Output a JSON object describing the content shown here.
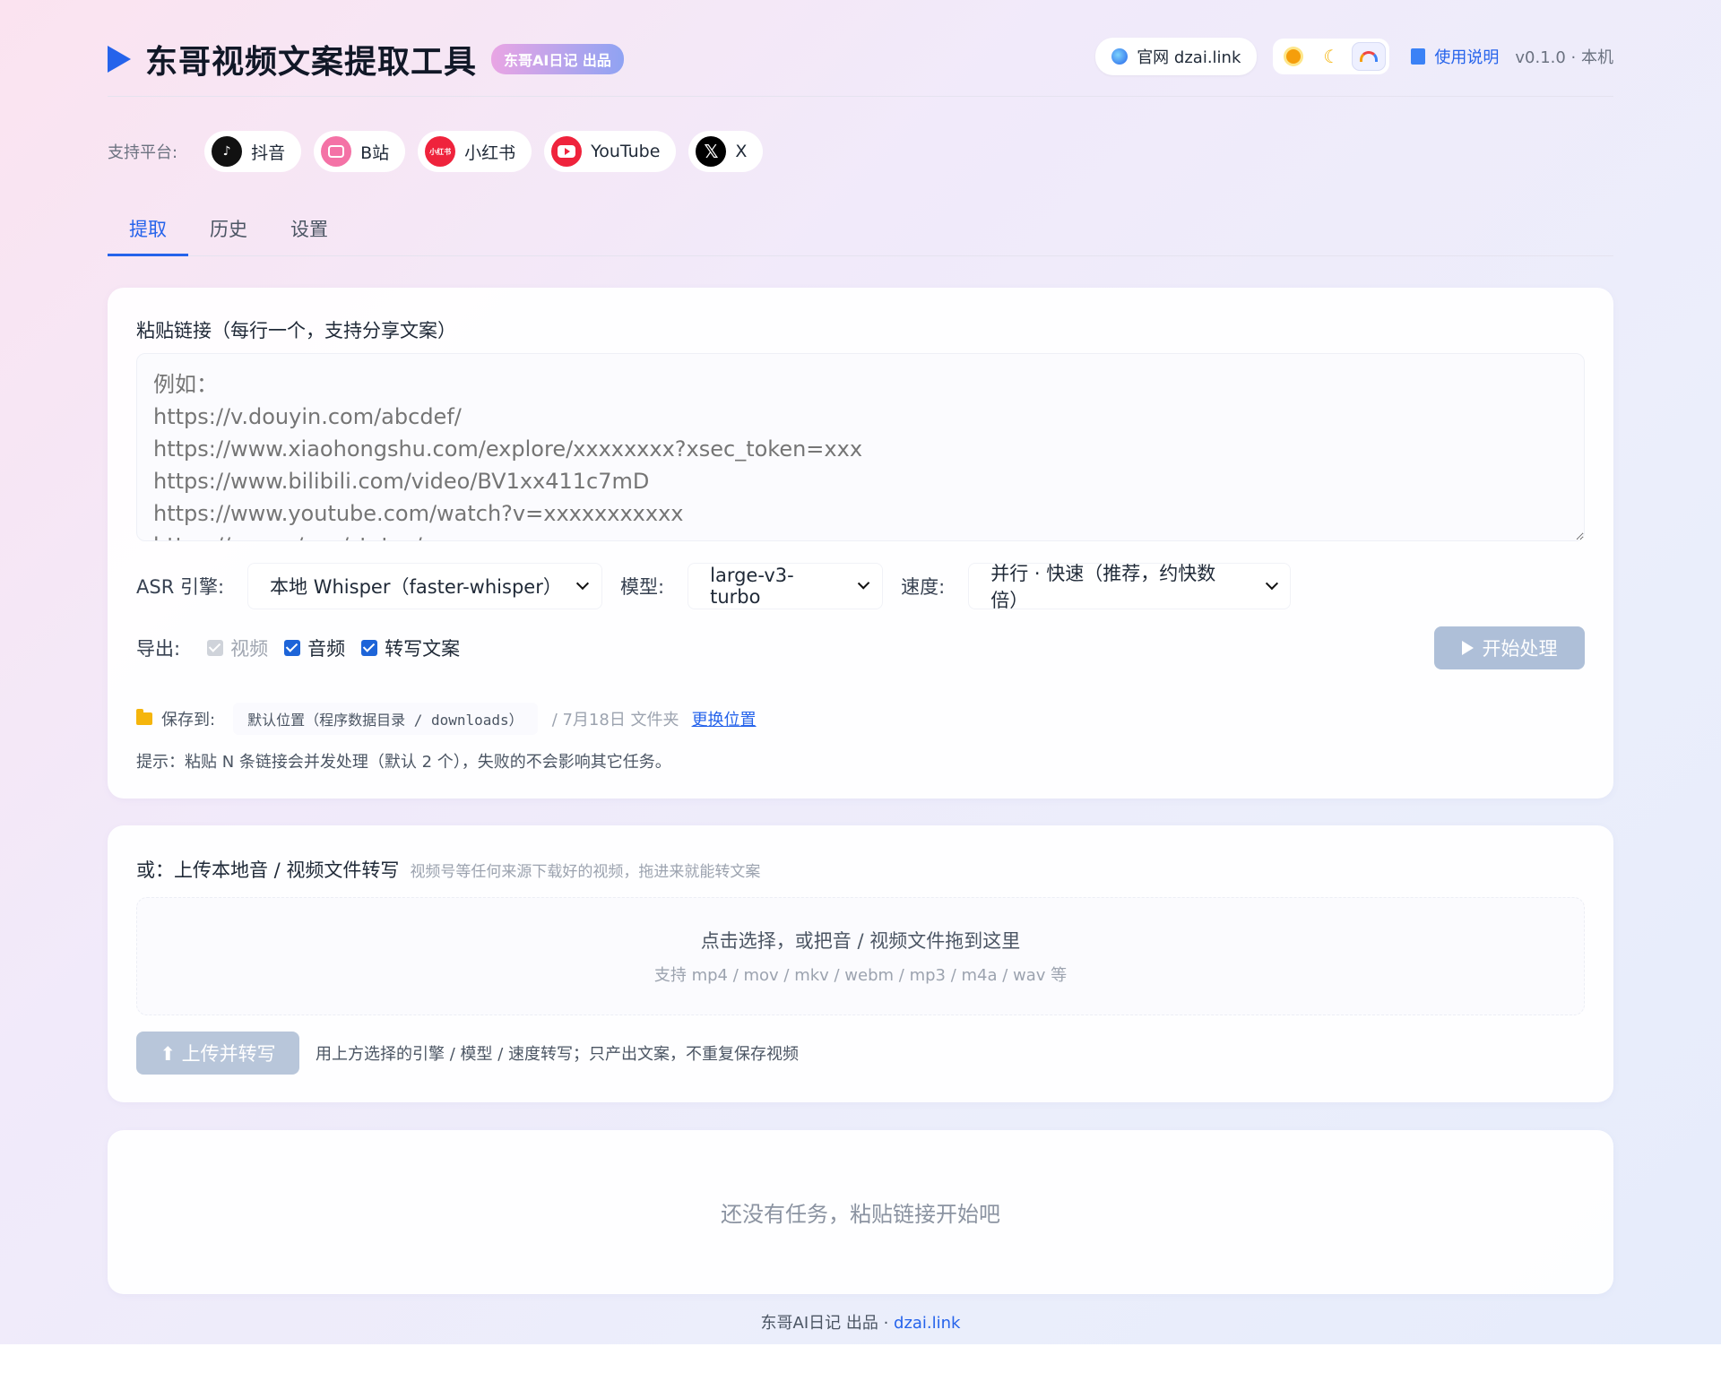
{
  "header": {
    "app_title": "东哥视频文案提取工具",
    "brand_badge": "东哥AI日记 出品",
    "site_label": "官网 dzai.link",
    "theme_options": [
      "sun-icon",
      "moon-icon",
      "rainbow-icon"
    ],
    "active_theme": "rainbow-icon",
    "guide_label": "使用说明",
    "version": "v0.1.0 · 本机"
  },
  "platforms": {
    "label": "支持平台:",
    "items": [
      {
        "name": "抖音",
        "icon": "tiktok-icon"
      },
      {
        "name": "B站",
        "icon": "bilibili-icon"
      },
      {
        "name": "小红书",
        "icon": "xiaohongshu-icon",
        "icon_text": "小红书"
      },
      {
        "name": "YouTube",
        "icon": "youtube-icon"
      },
      {
        "name": "X",
        "icon": "x-icon",
        "icon_text": "𝕏"
      }
    ]
  },
  "tabs": [
    {
      "label": "提取",
      "active": true
    },
    {
      "label": "历史",
      "active": false
    },
    {
      "label": "设置",
      "active": false
    }
  ],
  "extract": {
    "paste_label": "粘贴链接（每行一个，支持分享文案）",
    "placeholder": "例如：\nhttps://v.douyin.com/abcdef/\nhttps://www.xiaohongshu.com/explore/xxxxxxxx?xsec_token=xxx\nhttps://www.bilibili.com/video/BV1xx411c7mD\nhttps://www.youtube.com/watch?v=xxxxxxxxxxx\nhttps://x.com/xxx/status/xxx",
    "asr_label": "ASR 引擎:",
    "asr_value": "本地 Whisper（faster-whisper）",
    "model_label": "模型:",
    "model_value": "large-v3-turbo",
    "speed_label": "速度:",
    "speed_value": "并行 · 快速（推荐，约快数倍）",
    "export_label": "导出:",
    "exports": [
      {
        "label": "视频",
        "checked": true,
        "disabled": true
      },
      {
        "label": "音频",
        "checked": true,
        "disabled": false
      },
      {
        "label": "转写文案",
        "checked": true,
        "disabled": false
      }
    ],
    "start_button": "开始处理",
    "save_label": "保存到:",
    "save_path": "默认位置（程序数据目录 / downloads）",
    "save_note": "/ 7月18日 文件夹",
    "change_location": "更换位置",
    "hint": "提示：粘贴 N 条链接会并发处理（默认 2 个），失败的不会影响其它任务。"
  },
  "upload": {
    "title": "或：上传本地音 / 视频文件转写",
    "subtitle": "视频号等任何来源下载好的视频，拖进来就能转文案",
    "drop_main": "点击选择，或把音 / 视频文件拖到这里",
    "drop_sub": "支持 mp4 / mov / mkv / webm / mp3 / m4a / wav 等",
    "button": "⬆ 上传并转写",
    "note": "用上方选择的引擎 / 模型 / 速度转写；只产出文案，不重复保存视频"
  },
  "tasks": {
    "empty": "还没有任务，粘贴链接开始吧"
  },
  "footer": {
    "text": "东哥AI日记 出品 · ",
    "link": "dzai.link"
  },
  "colors": {
    "accent": "#2563eb",
    "disabled_button": "#aebfd8"
  }
}
